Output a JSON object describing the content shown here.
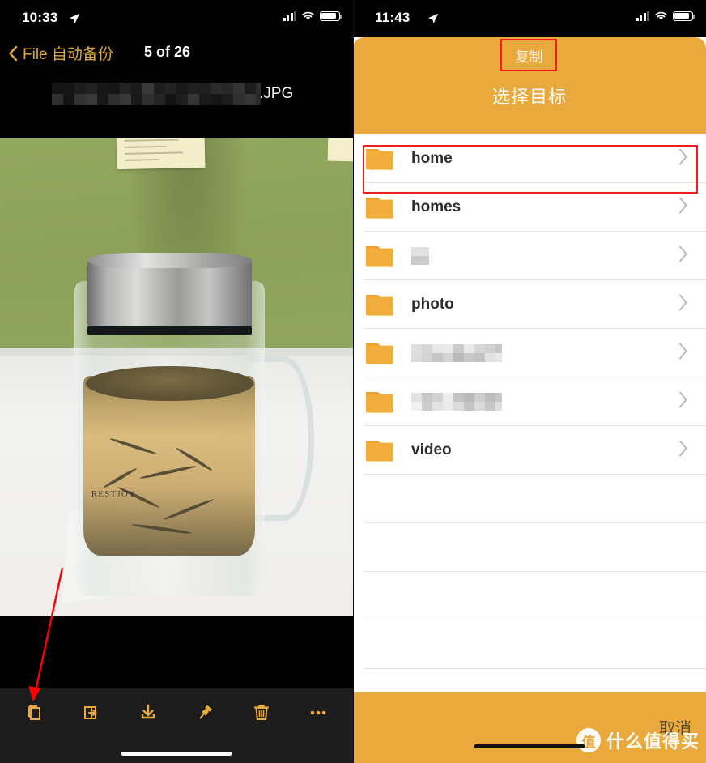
{
  "left": {
    "status_bar": {
      "time": "10:33",
      "location_icon": "location-arrow-icon",
      "signal_icon": "cellular-signal-icon",
      "wifi_icon": "wifi-icon",
      "battery_icon": "battery-icon"
    },
    "nav": {
      "back_icon": "chevron-left-icon",
      "back_label": "File 自动备份",
      "counter": "5 of 26"
    },
    "filename": {
      "redacted": true,
      "visible_suffix": ".JPG"
    },
    "photo": {
      "alt": "glass tea tumbler with steel lid on desk against green wall",
      "brand_text": "RESTJOY"
    },
    "toolbar": [
      {
        "name": "copy-button",
        "icon": "copy-pages-icon",
        "label": "复制"
      },
      {
        "name": "move-button",
        "icon": "move-out-icon",
        "label": "移动"
      },
      {
        "name": "download-button",
        "icon": "download-arrow-icon",
        "label": "下载"
      },
      {
        "name": "pin-button",
        "icon": "pushpin-icon",
        "label": "置顶"
      },
      {
        "name": "delete-button",
        "icon": "trash-icon",
        "label": "删除"
      },
      {
        "name": "more-button",
        "icon": "ellipsis-icon",
        "label": "更多"
      }
    ],
    "annotation": {
      "type": "red-arrow",
      "points_to": "copy-button",
      "color": "#ff0000"
    }
  },
  "right": {
    "status_bar": {
      "time": "11:43",
      "location_icon": "location-arrow-icon",
      "signal_icon": "cellular-signal-icon",
      "wifi_icon": "wifi-icon",
      "battery_icon": "battery-icon"
    },
    "sheet": {
      "action_label": "复制",
      "action_highlight_color": "#f31b1b",
      "title": "选择目标",
      "accent_color": "#eaa93c"
    },
    "folders": [
      {
        "label": "home",
        "redacted": false,
        "chevron": "chevron-right-icon"
      },
      {
        "label": "homes",
        "redacted": false,
        "chevron": "chevron-right-icon"
      },
      {
        "label": "",
        "redacted": true,
        "redact_width": 22,
        "chevron": "chevron-right-icon"
      },
      {
        "label": "photo",
        "redacted": false,
        "highlighted": true,
        "chevron": "chevron-right-icon"
      },
      {
        "label": "",
        "redacted": true,
        "redact_width": 112,
        "chevron": "chevron-right-icon"
      },
      {
        "label": "",
        "redacted": true,
        "redact_width": 112,
        "chevron": "chevron-right-icon"
      },
      {
        "label": "video",
        "redacted": false,
        "chevron": "chevron-right-icon"
      }
    ],
    "empty_row_count": 4,
    "footer": {
      "cancel_label": "取消"
    },
    "watermark": {
      "logo_char": "值",
      "text": "什么值得买"
    }
  }
}
